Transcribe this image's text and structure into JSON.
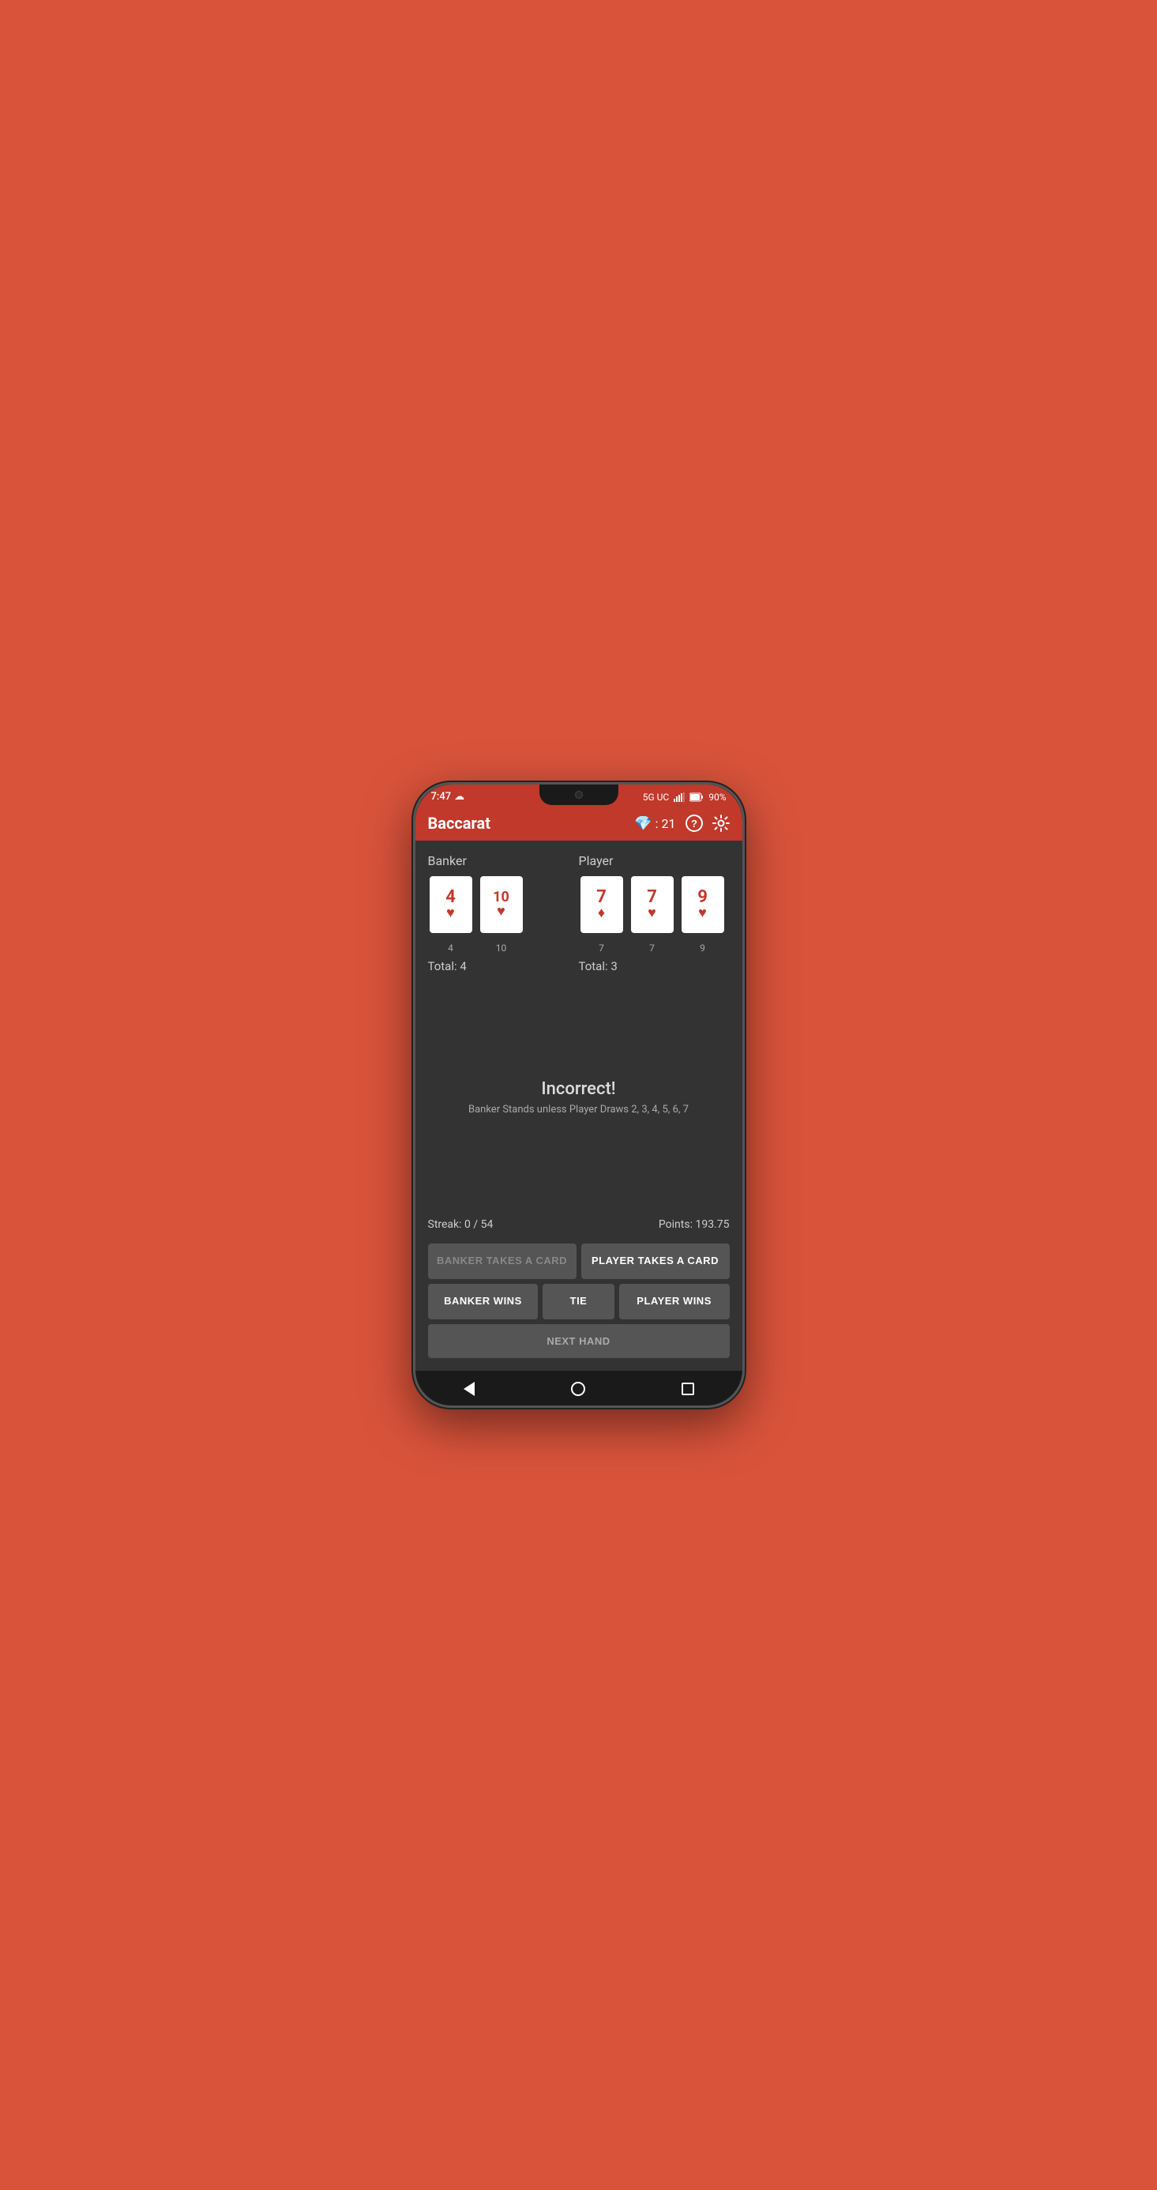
{
  "statusBar": {
    "time": "7:47",
    "network": "5G UC",
    "battery": "90%",
    "cloudIcon": "☁"
  },
  "appBar": {
    "title": "Baccarat",
    "gemScore": "21",
    "helpIcon": "?",
    "settingsIcon": "⚙"
  },
  "banker": {
    "label": "Banker",
    "cards": [
      {
        "value": "4",
        "suit": "♥",
        "suitType": "heart",
        "label": "4"
      },
      {
        "value": "10",
        "suit": "♥",
        "suitType": "heart",
        "label": "10"
      }
    ],
    "total": "Total: 4"
  },
  "player": {
    "label": "Player",
    "cards": [
      {
        "value": "7",
        "suit": "♦",
        "suitType": "diamond",
        "label": "7"
      },
      {
        "value": "7",
        "suit": "♥",
        "suitType": "heart",
        "label": "7"
      },
      {
        "value": "9",
        "suit": "♥",
        "suitType": "heart",
        "label": "9"
      }
    ],
    "total": "Total: 3"
  },
  "result": {
    "title": "Incorrect!",
    "subtitle": "Banker Stands unless Player Draws 2, 3, 4, 5, 6, 7"
  },
  "stats": {
    "streak": "Streak: 0 / 54",
    "points": "Points: 193.75"
  },
  "buttons": {
    "bankerTakesCard": "BANKER TAKES A CARD",
    "playerTakesCard": "PLAYER TAKES A CARD",
    "bankerWins": "BANKER WINS",
    "tie": "TIE",
    "playerWins": "PLAYER WINS",
    "nextHand": "NEXT HAND"
  },
  "navbar": {
    "back": "back",
    "home": "home",
    "recent": "recent"
  }
}
